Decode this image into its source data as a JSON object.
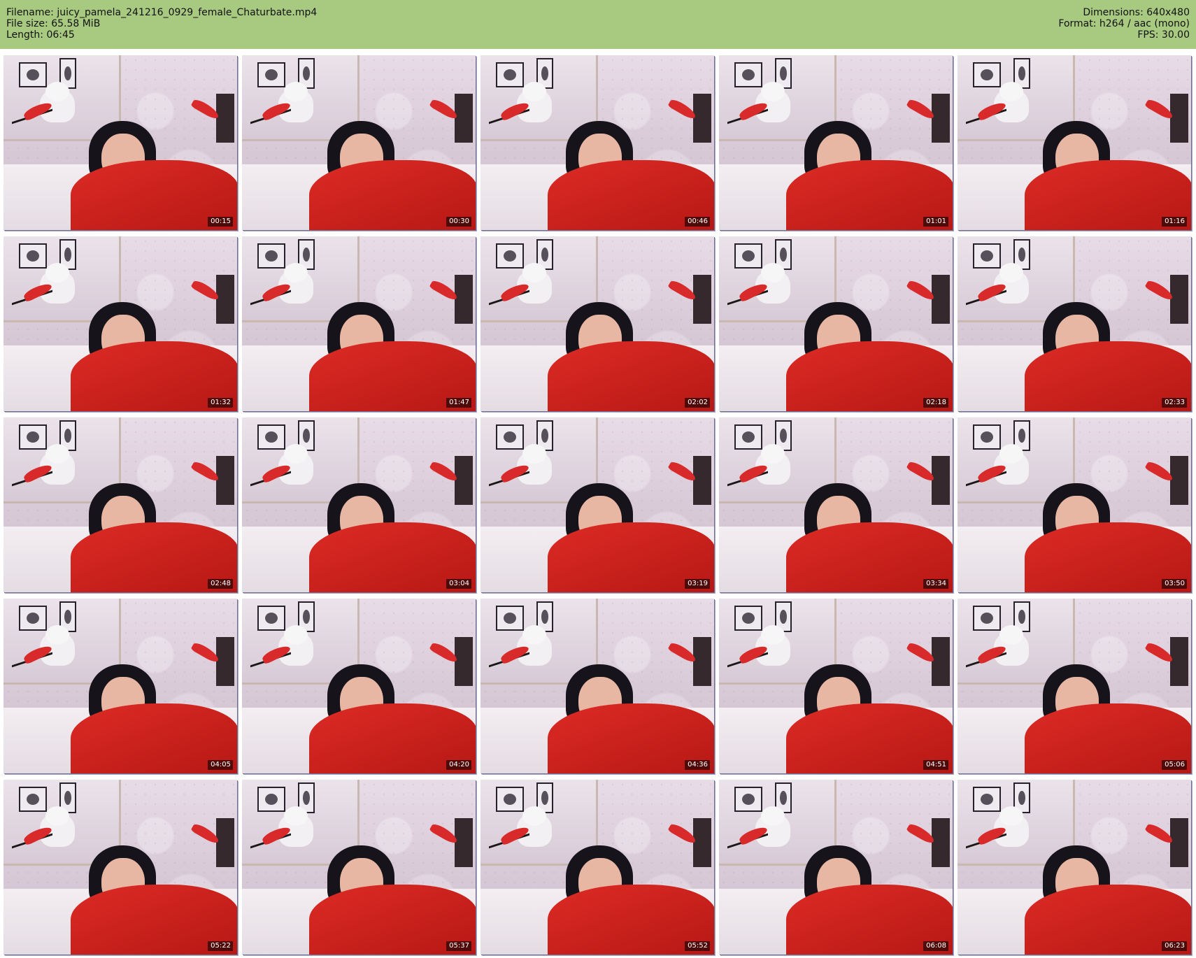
{
  "header": {
    "filename_label": "Filename:",
    "filename": "juicy_pamela_241216_0929_female_Chaturbate.mp4",
    "file_size_label": "File size:",
    "file_size": "65.58 MiB",
    "length_label": "Length:",
    "length": "06:45",
    "dimensions_label": "Dimensions:",
    "dimensions": "640x480",
    "format_label": "Format:",
    "format": "h264 / aac (mono)",
    "fps_label": "FPS:",
    "fps": "30.00"
  },
  "thumbnails": [
    {
      "timestamp": "00:15"
    },
    {
      "timestamp": "00:30"
    },
    {
      "timestamp": "00:46"
    },
    {
      "timestamp": "01:01"
    },
    {
      "timestamp": "01:16"
    },
    {
      "timestamp": "01:32"
    },
    {
      "timestamp": "01:47"
    },
    {
      "timestamp": "02:02"
    },
    {
      "timestamp": "02:18"
    },
    {
      "timestamp": "02:33"
    },
    {
      "timestamp": "02:48"
    },
    {
      "timestamp": "03:04"
    },
    {
      "timestamp": "03:19"
    },
    {
      "timestamp": "03:34"
    },
    {
      "timestamp": "03:50"
    },
    {
      "timestamp": "04:05"
    },
    {
      "timestamp": "04:20"
    },
    {
      "timestamp": "04:36"
    },
    {
      "timestamp": "04:51"
    },
    {
      "timestamp": "05:06"
    },
    {
      "timestamp": "05:22"
    },
    {
      "timestamp": "05:37"
    },
    {
      "timestamp": "05:52"
    },
    {
      "timestamp": "06:08"
    },
    {
      "timestamp": "06:23"
    }
  ],
  "colors": {
    "header_background": "#a8c980",
    "timestamp_background": "#000000",
    "timestamp_text": "#ffffff"
  }
}
